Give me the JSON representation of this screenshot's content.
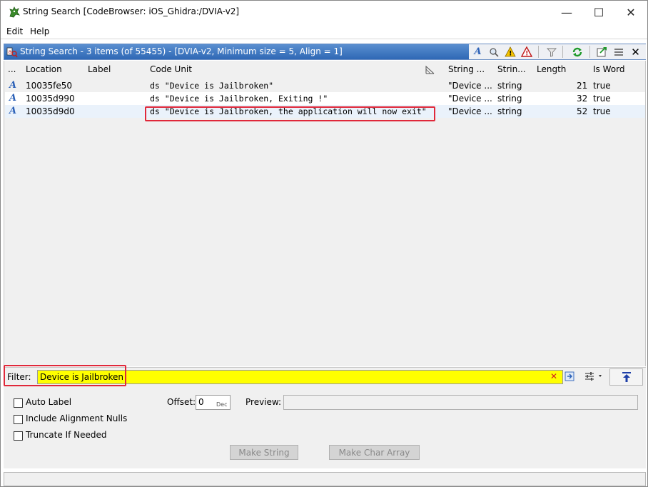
{
  "window": {
    "title": "String Search [CodeBrowser: iOS_Ghidra:/DVIA-v2]",
    "minimize": "—",
    "maximize": "☐",
    "close": "✕"
  },
  "menu": {
    "items": [
      "Edit",
      "Help"
    ]
  },
  "panel": {
    "title": "String Search - 3 items (of 55455) - [DVIA-v2, Minimum size = 5, Align = 1]"
  },
  "table": {
    "columns": [
      "...",
      "Location",
      "Label",
      "Code Unit",
      "String ...",
      "Strin...",
      "Length",
      "Is Word"
    ],
    "rows": [
      {
        "location": "10035fe50",
        "label": "",
        "code_unit": "ds \"Device is Jailbroken\"",
        "string": "\"Device ...",
        "type": "string",
        "length": "21",
        "is_word": "true"
      },
      {
        "location": "10035d990",
        "label": "",
        "code_unit": "ds \"Device is Jailbroken, Exiting !\"",
        "string": "\"Device ...",
        "type": "string",
        "length": "32",
        "is_word": "true"
      },
      {
        "location": "10035d9d0",
        "label": "",
        "code_unit": "ds \"Device is Jailbroken, the application will now exit\"",
        "string": "\"Device ...",
        "type": "string",
        "length": "52",
        "is_word": "true"
      }
    ]
  },
  "filter": {
    "label": "Filter:",
    "value": "Device is Jailbroken"
  },
  "options": {
    "auto_label": "Auto Label",
    "include_alignment_nulls": "Include Alignment Nulls",
    "truncate_if_needed": "Truncate If Needed",
    "offset_label": "Offset:",
    "offset_value": "0",
    "offset_base": "Dec",
    "preview_label": "Preview:",
    "make_string": "Make String",
    "make_char_array": "Make Char Array"
  },
  "colors": {
    "highlight": "#e0283a",
    "filter_bg": "#ffff00",
    "header_blue": "#2f68b5"
  }
}
